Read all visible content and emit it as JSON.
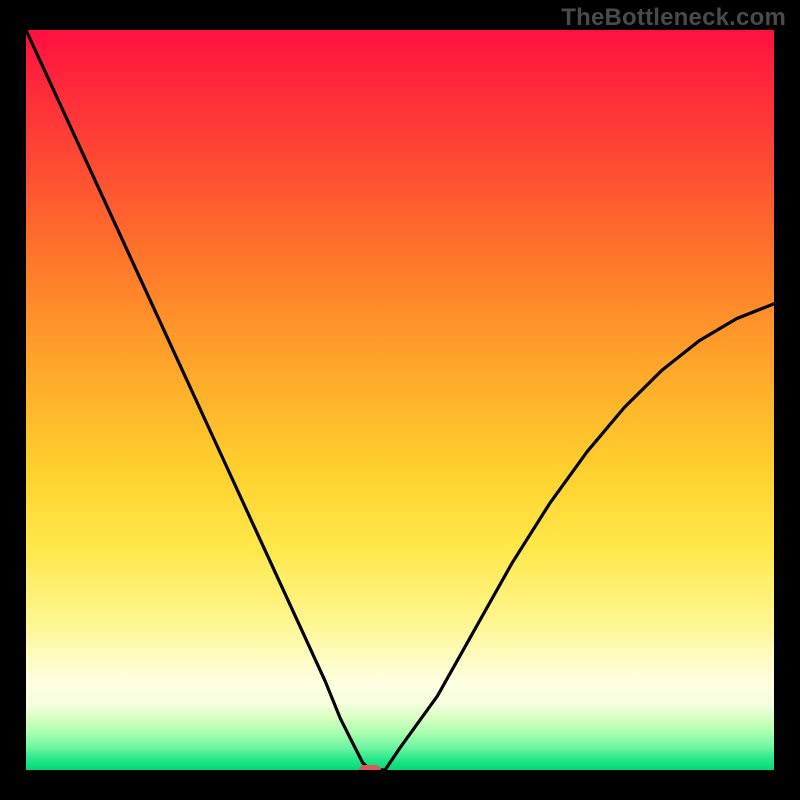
{
  "watermark": "TheBottleneck.com",
  "chart_data": {
    "type": "line",
    "title": "",
    "xlabel": "",
    "ylabel": "",
    "xlim": [
      0,
      100
    ],
    "ylim": [
      0,
      100
    ],
    "grid": false,
    "legend": false,
    "series": [
      {
        "name": "bottleneck-curve",
        "x": [
          0,
          5,
          10,
          15,
          20,
          25,
          30,
          35,
          40,
          42,
          44,
          45,
          46,
          48,
          50,
          55,
          60,
          65,
          70,
          75,
          80,
          85,
          90,
          95,
          100
        ],
        "values": [
          100,
          89,
          78,
          67,
          56,
          45,
          34,
          23,
          12,
          7,
          3,
          1,
          0,
          0,
          3,
          10,
          19,
          28,
          36,
          43,
          49,
          54,
          58,
          61,
          63
        ]
      }
    ],
    "marker": {
      "x": 46,
      "y": 0,
      "color": "#d85a5a"
    },
    "background_gradient": {
      "top": "#ff1040",
      "mid": "#ffe84a",
      "bottom": "#00d874"
    }
  }
}
